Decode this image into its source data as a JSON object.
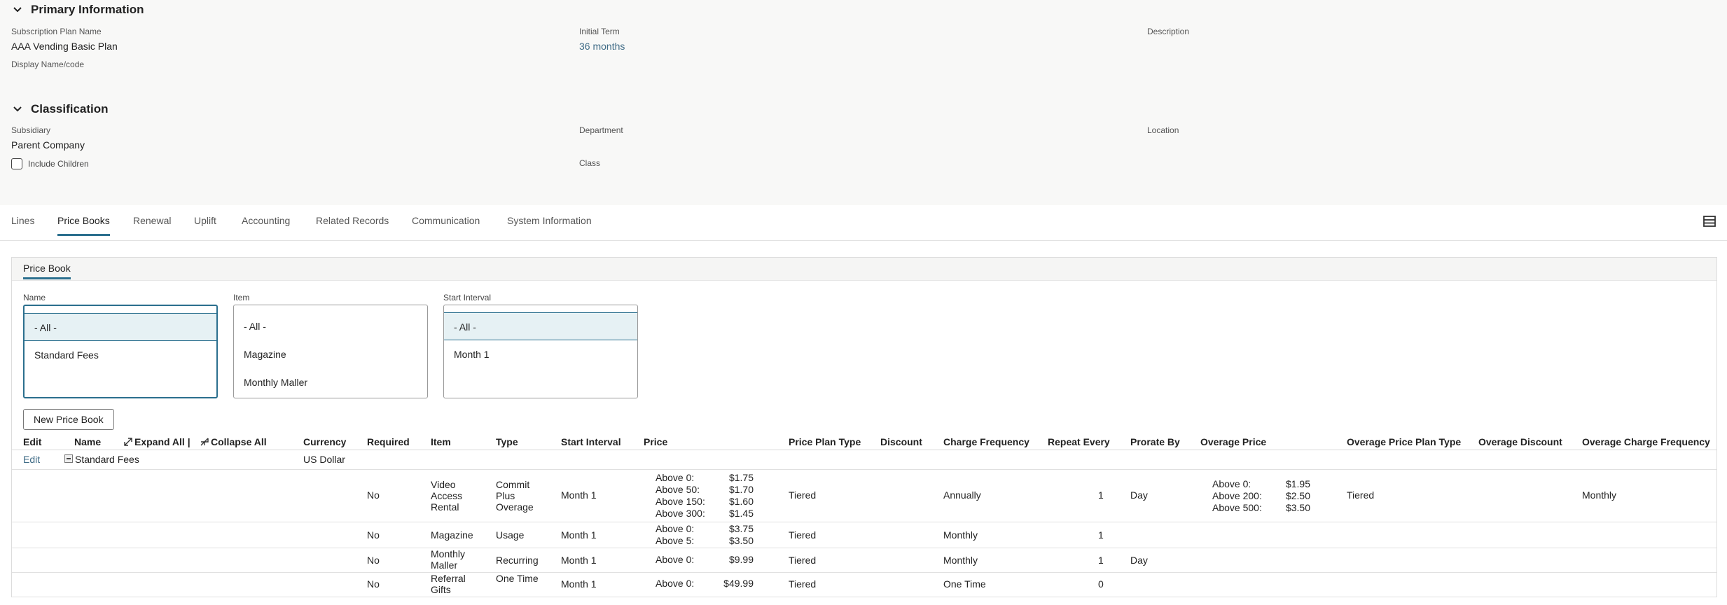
{
  "primary": {
    "title": "Primary Information",
    "fields": {
      "plan_name_label": "Subscription Plan Name",
      "plan_name_value": "AAA Vending Basic Plan",
      "initial_term_label": "Initial Term",
      "initial_term_value": "36 months",
      "description_label": "Description",
      "display_name_label": "Display Name/code"
    }
  },
  "classification": {
    "title": "Classification",
    "subsidiary_label": "Subsidiary",
    "subsidiary_value": "Parent Company",
    "include_children_label": "Include Children",
    "department_label": "Department",
    "location_label": "Location",
    "class_label": "Class"
  },
  "tabs": [
    "Lines",
    "Price Books",
    "Renewal",
    "Uplift",
    "Accounting",
    "Related Records",
    "Communication",
    "System Information"
  ],
  "price_book": {
    "subtab": "Price Book",
    "filters": {
      "name": {
        "label": "Name",
        "options": [
          "- All -",
          "Standard Fees"
        ]
      },
      "item": {
        "label": "Item",
        "options": [
          "- All -",
          "Magazine",
          "Monthly Maller"
        ]
      },
      "start_interval": {
        "label": "Start Interval",
        "options": [
          "- All -",
          "Month 1"
        ]
      }
    },
    "new_button": "New Price Book",
    "columns": {
      "edit": "Edit",
      "name": "Name",
      "expand_all": "Expand All |",
      "collapse_all": "Collapse All",
      "currency": "Currency",
      "required": "Required",
      "item": "Item",
      "type": "Type",
      "start_interval": "Start Interval",
      "price": "Price",
      "price_plan_type": "Price Plan Type",
      "discount": "Discount",
      "charge_frequency": "Charge Frequency",
      "repeat_every": "Repeat Every",
      "prorate_by": "Prorate By",
      "overage_price": "Overage Price",
      "overage_price_plan_type": "Overage Price Plan Type",
      "overage_discount": "Overage Discount",
      "overage_charge_frequency": "Overage Charge Frequency"
    },
    "group": {
      "edit": "Edit",
      "name": "Standard Fees",
      "currency": "US Dollar"
    },
    "rows": [
      {
        "required": "No",
        "item": "Video Access Rental",
        "type": "Commit Plus Overage",
        "start_interval": "Month 1",
        "price_tiers": [
          [
            "Above 0:",
            "$1.75"
          ],
          [
            "Above 50:",
            "$1.70"
          ],
          [
            "Above 150:",
            "$1.60"
          ],
          [
            "Above 300:",
            "$1.45"
          ]
        ],
        "price_plan_type": "Tiered",
        "charge_frequency": "Annually",
        "repeat_every": "1",
        "prorate_by": "Day",
        "overage_tiers": [
          [
            "Above 0:",
            "$1.95"
          ],
          [
            "Above 200:",
            "$2.50"
          ],
          [
            "Above 500:",
            "$3.50"
          ]
        ],
        "overage_price_plan_type": "Tiered",
        "overage_charge_frequency": "Monthly"
      },
      {
        "required": "No",
        "item": "Magazine",
        "type": "Usage",
        "start_interval": "Month 1",
        "price_tiers": [
          [
            "Above 0:",
            "$3.75"
          ],
          [
            "Above 5:",
            "$3.50"
          ]
        ],
        "price_plan_type": "Tiered",
        "charge_frequency": "Monthly",
        "repeat_every": "1"
      },
      {
        "required": "No",
        "item": "Monthly Maller",
        "type": "Recurring",
        "start_interval": "Month 1",
        "price_tiers": [
          [
            "Above 0:",
            "$9.99"
          ]
        ],
        "price_plan_type": "Tiered",
        "charge_frequency": "Monthly",
        "repeat_every": "1",
        "prorate_by": "Day"
      },
      {
        "required": "No",
        "item": "Referral Gifts",
        "type": "One Time",
        "start_interval": "Month 1",
        "price_tiers": [
          [
            "Above 0:",
            "$49.99"
          ]
        ],
        "price_plan_type": "Tiered",
        "charge_frequency": "One Time",
        "repeat_every": "0"
      }
    ]
  }
}
